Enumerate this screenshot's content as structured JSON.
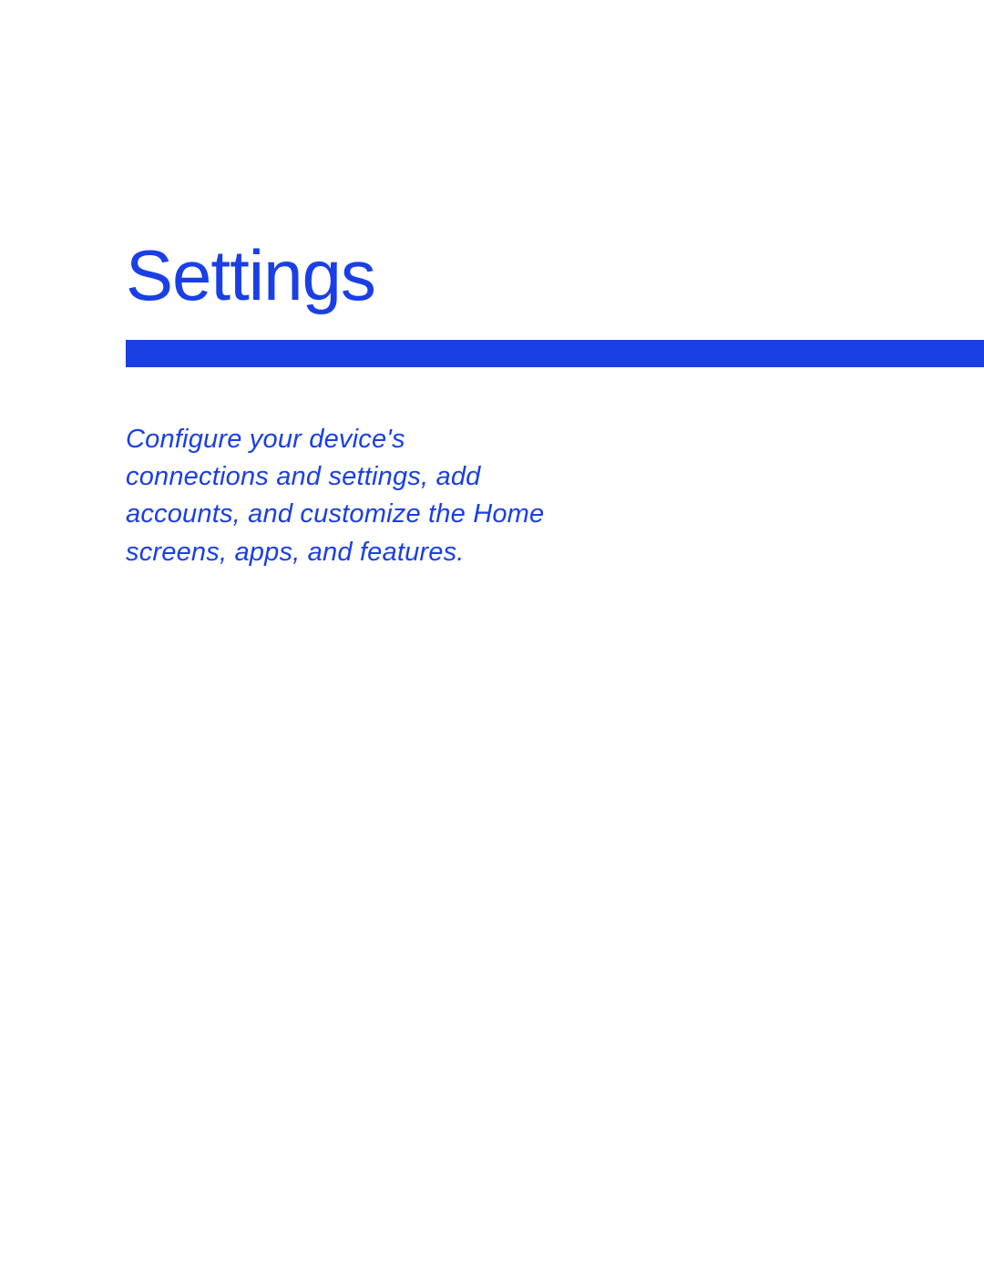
{
  "header": {
    "title": "Settings"
  },
  "body": {
    "description": "Configure your device's connections and settings, add accounts, and customize the Home screens, apps, and features."
  }
}
